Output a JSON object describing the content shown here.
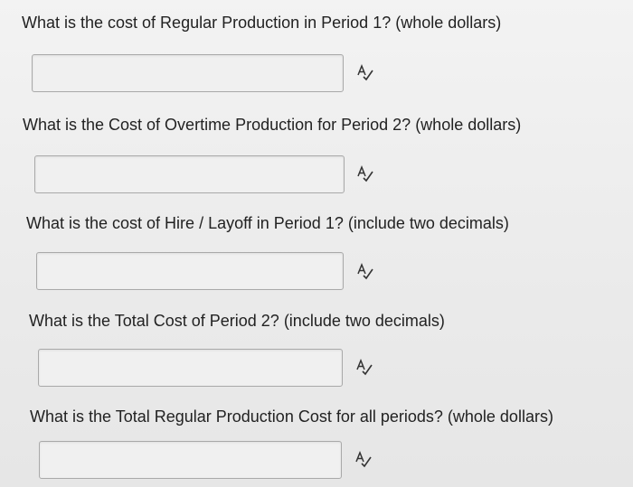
{
  "questions": [
    {
      "label": "What is the cost of Regular Production in Period 1? (whole dollars)",
      "value": "",
      "placeholder": ""
    },
    {
      "label": "What is the Cost of Overtime Production for Period 2? (whole dollars)",
      "value": "",
      "placeholder": ""
    },
    {
      "label": "What is the cost of Hire / Layoff in Period 1? (include two decimals)",
      "value": "",
      "placeholder": ""
    },
    {
      "label": "What is the Total Cost of Period 2? (include two decimals)",
      "value": "",
      "placeholder": ""
    },
    {
      "label": "What is the Total Regular Production Cost for all periods? (whole dollars)",
      "value": "",
      "placeholder": ""
    }
  ],
  "icons": {
    "spellcheck": "spellcheck-icon"
  },
  "colors": {
    "background": "#ededed",
    "text": "#222222",
    "input_border": "#a9a9a9",
    "input_fill": "#f0f0f0"
  }
}
